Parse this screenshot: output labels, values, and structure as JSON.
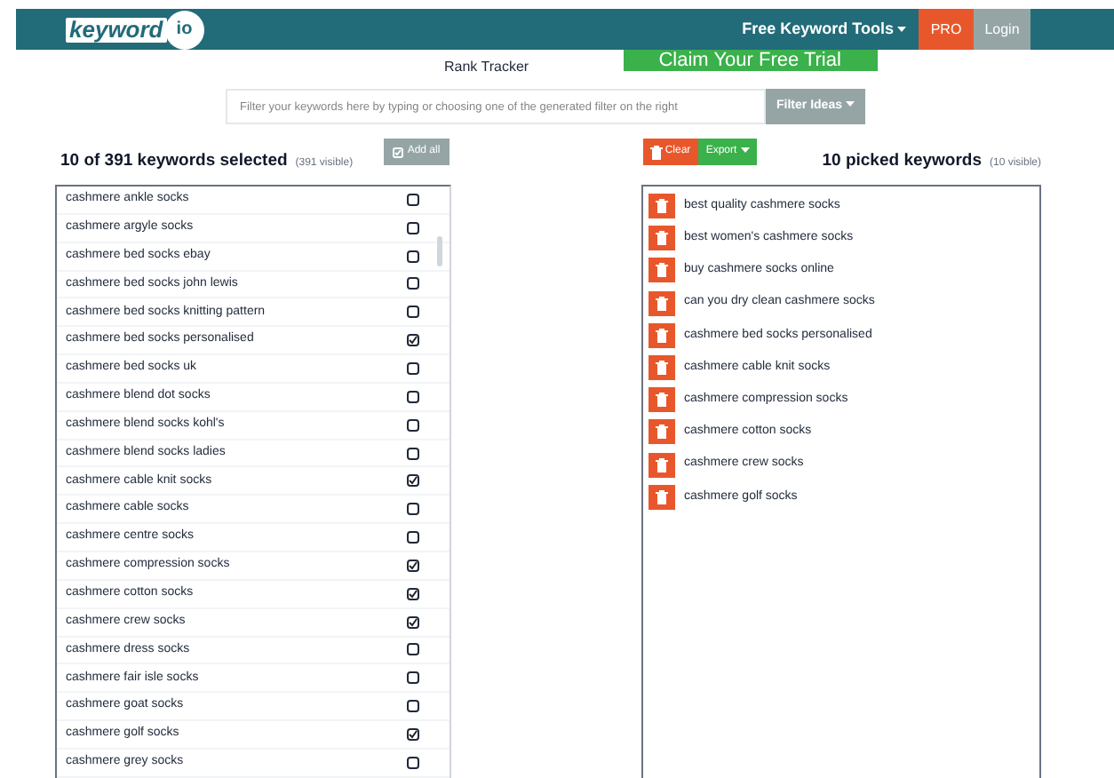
{
  "header": {
    "logo_word": "keyword",
    "logo_suffix": "io",
    "menu": "Free Keyword Tools",
    "pro": "PRO",
    "login": "Login"
  },
  "banner": {
    "caption": "Rank Tracker",
    "cta": "Claim Your Free Trial"
  },
  "filter": {
    "placeholder": "Filter your keywords here by typing or choosing one of the generated filter on the right",
    "button": "Filter Ideas"
  },
  "left": {
    "add_all": "Add all",
    "title": "10 of 391 keywords selected",
    "note": "(391 visible)",
    "keywords": [
      {
        "text": "cashmere ankle socks",
        "checked": false
      },
      {
        "text": "cashmere argyle socks",
        "checked": false
      },
      {
        "text": "cashmere bed socks ebay",
        "checked": false
      },
      {
        "text": "cashmere bed socks john lewis",
        "checked": false
      },
      {
        "text": "cashmere bed socks knitting pattern",
        "checked": false
      },
      {
        "text": "cashmere bed socks personalised",
        "checked": true
      },
      {
        "text": "cashmere bed socks uk",
        "checked": false
      },
      {
        "text": "cashmere blend dot socks",
        "checked": false
      },
      {
        "text": "cashmere blend socks kohl's",
        "checked": false
      },
      {
        "text": "cashmere blend socks ladies",
        "checked": false
      },
      {
        "text": "cashmere cable knit socks",
        "checked": true
      },
      {
        "text": "cashmere cable socks",
        "checked": false
      },
      {
        "text": "cashmere centre socks",
        "checked": false
      },
      {
        "text": "cashmere compression socks",
        "checked": true
      },
      {
        "text": "cashmere cotton socks",
        "checked": true
      },
      {
        "text": "cashmere crew socks",
        "checked": true
      },
      {
        "text": "cashmere dress socks",
        "checked": false
      },
      {
        "text": "cashmere fair isle socks",
        "checked": false
      },
      {
        "text": "cashmere goat socks",
        "checked": false
      },
      {
        "text": "cashmere golf socks",
        "checked": true
      },
      {
        "text": "cashmere grey socks",
        "checked": false
      }
    ]
  },
  "right": {
    "clear": "Clear",
    "export": "Export",
    "title": "10 picked keywords",
    "note": "(10 visible)",
    "keywords": [
      "best quality cashmere socks",
      "best women's cashmere socks",
      "buy cashmere socks online",
      "can you dry clean cashmere socks",
      "cashmere bed socks personalised",
      "cashmere cable knit socks",
      "cashmere compression socks",
      "cashmere cotton socks",
      "cashmere crew socks",
      "cashmere golf socks"
    ]
  }
}
